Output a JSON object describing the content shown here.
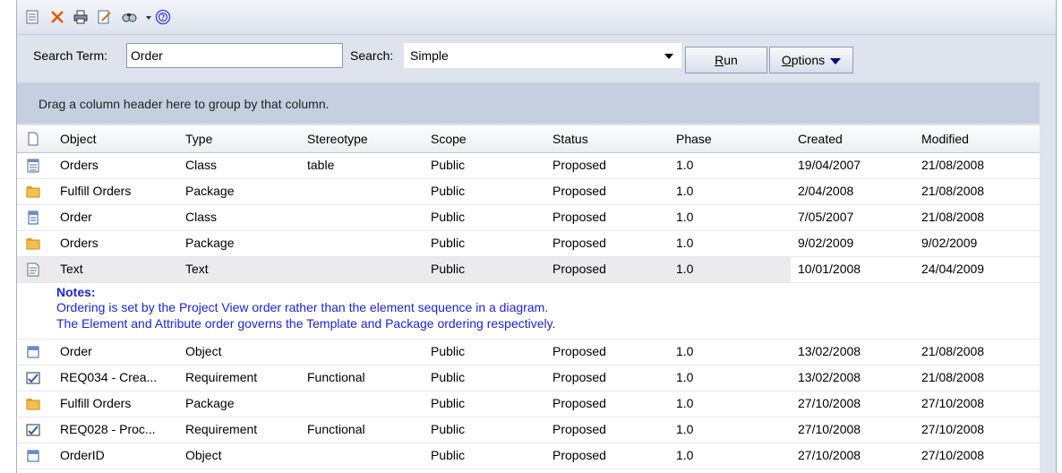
{
  "toolbar": {
    "icons": [
      "new-icon",
      "delete-icon",
      "print-icon",
      "edit-icon",
      "find-icon",
      "dropdown-icon",
      "help-icon"
    ]
  },
  "search": {
    "term_label": "Search Term:",
    "term_value": "Order",
    "search_label": "Search:",
    "search_value": "Simple",
    "run_label_u": "R",
    "run_label_rest": "un",
    "options_label_u": "O",
    "options_label_rest": "ptions"
  },
  "group_panel": {
    "text": "Drag a column header here to group by that column."
  },
  "columns": [
    "Object",
    "Type",
    "Stereotype",
    "Scope",
    "Status",
    "Phase",
    "Created",
    "Modified"
  ],
  "rows": [
    {
      "icon": "class-table-icon",
      "object": "Orders",
      "type": "Class",
      "stereotype": "table",
      "scope": "Public",
      "status": "Proposed",
      "phase": "1.0",
      "created": "19/04/2007",
      "modified": "21/08/2008"
    },
    {
      "icon": "package-icon",
      "object": "Fulfill Orders",
      "type": "Package",
      "stereotype": "",
      "scope": "Public",
      "status": "Proposed",
      "phase": "1.0",
      "created": "2/04/2008",
      "modified": "21/08/2008"
    },
    {
      "icon": "class-icon",
      "object": "Order",
      "type": "Class",
      "stereotype": "",
      "scope": "Public",
      "status": "Proposed",
      "phase": "1.0",
      "created": "7/05/2007",
      "modified": "21/08/2008"
    },
    {
      "icon": "package-icon",
      "object": "Orders",
      "type": "Package",
      "stereotype": "",
      "scope": "Public",
      "status": "Proposed",
      "phase": "1.0",
      "created": "9/02/2009",
      "modified": "9/02/2009"
    },
    {
      "icon": "text-icon",
      "object": "Text",
      "type": "Text",
      "stereotype": "",
      "scope": "Public",
      "status": "Proposed",
      "phase": "1.0",
      "created": "10/01/2008",
      "modified": "24/04/2009"
    },
    {
      "icon": "object-icon",
      "object": "Order",
      "type": "Object",
      "stereotype": "",
      "scope": "Public",
      "status": "Proposed",
      "phase": "1.0",
      "created": "13/02/2008",
      "modified": "21/08/2008"
    },
    {
      "icon": "requirement-icon",
      "object": "REQ034 - Crea...",
      "type": "Requirement",
      "stereotype": "Functional",
      "scope": "Public",
      "status": "Proposed",
      "phase": "1.0",
      "created": "13/02/2008",
      "modified": "21/08/2008"
    },
    {
      "icon": "package-icon",
      "object": "Fulfill Orders",
      "type": "Package",
      "stereotype": "",
      "scope": "Public",
      "status": "Proposed",
      "phase": "1.0",
      "created": "27/10/2008",
      "modified": "27/10/2008"
    },
    {
      "icon": "requirement-icon",
      "object": "REQ028 - Proc...",
      "type": "Requirement",
      "stereotype": "Functional",
      "scope": "Public",
      "status": "Proposed",
      "phase": "1.0",
      "created": "27/10/2008",
      "modified": "27/10/2008"
    },
    {
      "icon": "object-icon",
      "object": "OrderID",
      "type": "Object",
      "stereotype": "",
      "scope": "Public",
      "status": "Proposed",
      "phase": "1.0",
      "created": "27/10/2008",
      "modified": "27/10/2008"
    }
  ],
  "notes": {
    "title": "Notes:",
    "line1": "Ordering is set by the Project View order rather than the element sequence in a diagram.",
    "line2": "The Element and Attribute order governs the Template and Package ordering respectively."
  }
}
